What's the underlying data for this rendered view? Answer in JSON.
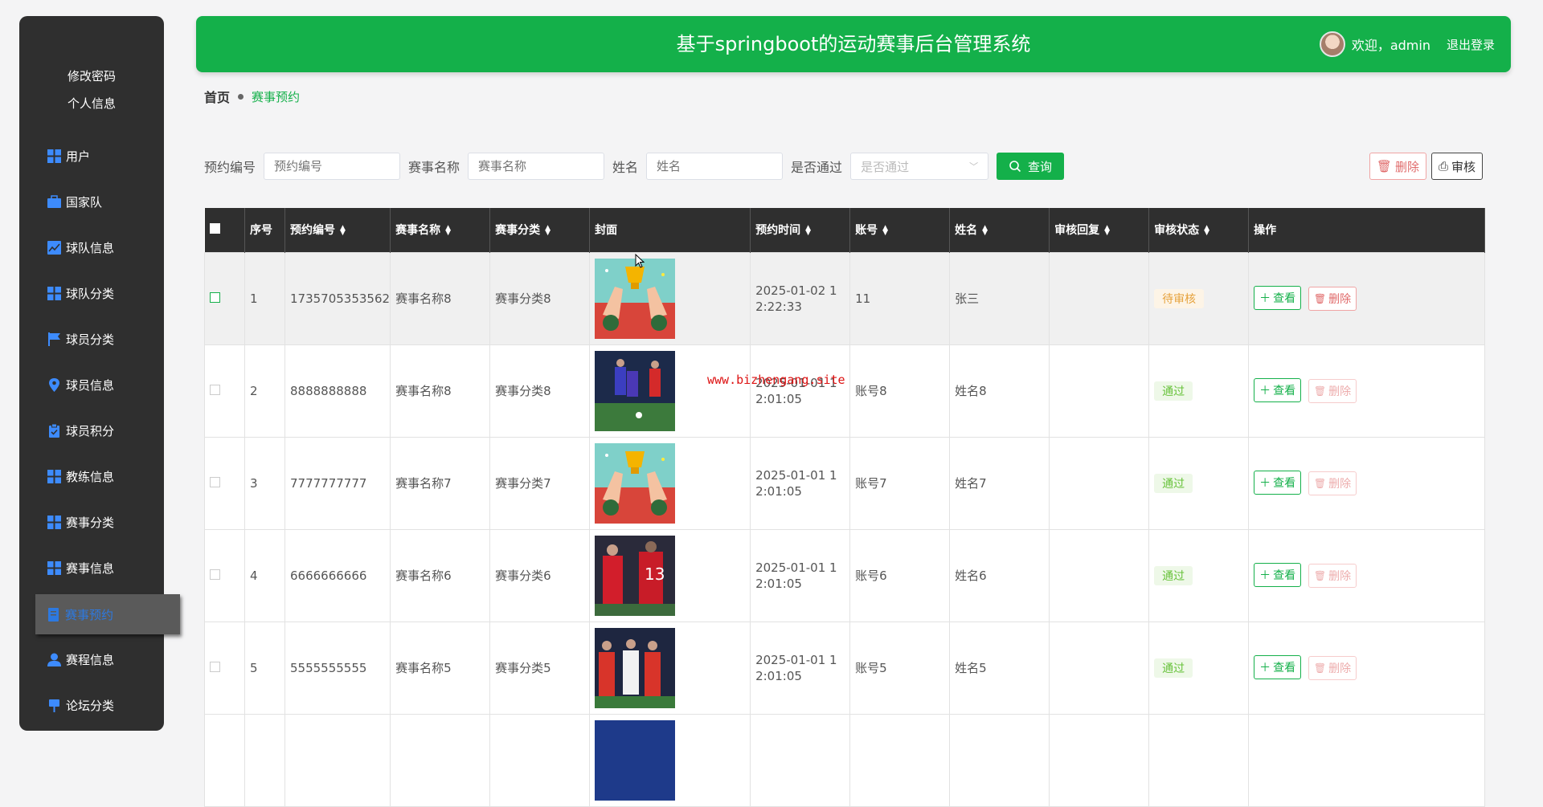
{
  "sidebar": {
    "top_links": [
      "修改密码",
      "个人信息"
    ],
    "items": [
      {
        "label": "用户",
        "icon": "grid-icon"
      },
      {
        "label": "国家队",
        "icon": "briefcase-icon"
      },
      {
        "label": "球队信息",
        "icon": "chart-icon"
      },
      {
        "label": "球队分类",
        "icon": "grid-icon"
      },
      {
        "label": "球员分类",
        "icon": "flag-icon"
      },
      {
        "label": "球员信息",
        "icon": "location-icon"
      },
      {
        "label": "球员积分",
        "icon": "clipboard-icon"
      },
      {
        "label": "教练信息",
        "icon": "grid-icon"
      },
      {
        "label": "赛事分类",
        "icon": "grid-icon"
      },
      {
        "label": "赛事信息",
        "icon": "grid-icon"
      },
      {
        "label": "赛事预约",
        "icon": "document-icon",
        "active": true
      },
      {
        "label": "赛程信息",
        "icon": "user-icon"
      },
      {
        "label": "论坛分类",
        "icon": "pin-icon"
      }
    ]
  },
  "header": {
    "title": "基于springboot的运动赛事后台管理系统",
    "welcome": "欢迎，admin",
    "logout": "退出登录"
  },
  "breadcrumb": {
    "home": "首页",
    "current": "赛事预约"
  },
  "search": {
    "fields": [
      {
        "label": "预约编号",
        "placeholder": "预约编号"
      },
      {
        "label": "赛事名称",
        "placeholder": "赛事名称"
      },
      {
        "label": "姓名",
        "placeholder": "姓名"
      }
    ],
    "select_label": "是否通过",
    "select_placeholder": "是否通过",
    "query_label": "查询"
  },
  "actions": {
    "delete": "删除",
    "audit": "审核"
  },
  "table": {
    "headers": [
      "序号",
      "预约编号",
      "赛事名称",
      "赛事分类",
      "封面",
      "预约时间",
      "账号",
      "姓名",
      "审核回复",
      "审核状态",
      "操作"
    ],
    "rows": [
      {
        "idx": "1",
        "code": "1735705353562",
        "name": "赛事名称8",
        "cat": "赛事分类8",
        "cover": "trophy",
        "time": "2025-01-02 12:22:33",
        "account": "11",
        "person": "张三",
        "reply": "",
        "status": "待审核",
        "status_type": "pending"
      },
      {
        "idx": "2",
        "code": "8888888888",
        "name": "赛事名称8",
        "cat": "赛事分类8",
        "cover": "match-blue",
        "time": "2025-01-01 12:01:05",
        "account": "账号8",
        "person": "姓名8",
        "reply": "",
        "status": "通过",
        "status_type": "pass"
      },
      {
        "idx": "3",
        "code": "7777777777",
        "name": "赛事名称7",
        "cat": "赛事分类7",
        "cover": "trophy",
        "time": "2025-01-01 12:01:05",
        "account": "账号7",
        "person": "姓名7",
        "reply": "",
        "status": "通过",
        "status_type": "pass"
      },
      {
        "idx": "4",
        "code": "6666666666",
        "name": "赛事名称6",
        "cat": "赛事分类6",
        "cover": "match-red",
        "time": "2025-01-01 12:01:05",
        "account": "账号6",
        "person": "姓名6",
        "reply": "",
        "status": "通过",
        "status_type": "pass"
      },
      {
        "idx": "5",
        "code": "5555555555",
        "name": "赛事名称5",
        "cat": "赛事分类5",
        "cover": "match-red2",
        "time": "2025-01-01 12:01:05",
        "account": "账号5",
        "person": "姓名5",
        "reply": "",
        "status": "通过",
        "status_type": "pass"
      }
    ],
    "view_label": "查看",
    "delete_label": "删除"
  },
  "watermark": "www.bizhengang.site",
  "colors": {
    "primary": "#14b04a",
    "sidebar": "#2f2f2f",
    "active_text": "#2d79e0",
    "danger": "#e06a6a",
    "pending": "#e6a23c",
    "pass": "#67c23a"
  }
}
